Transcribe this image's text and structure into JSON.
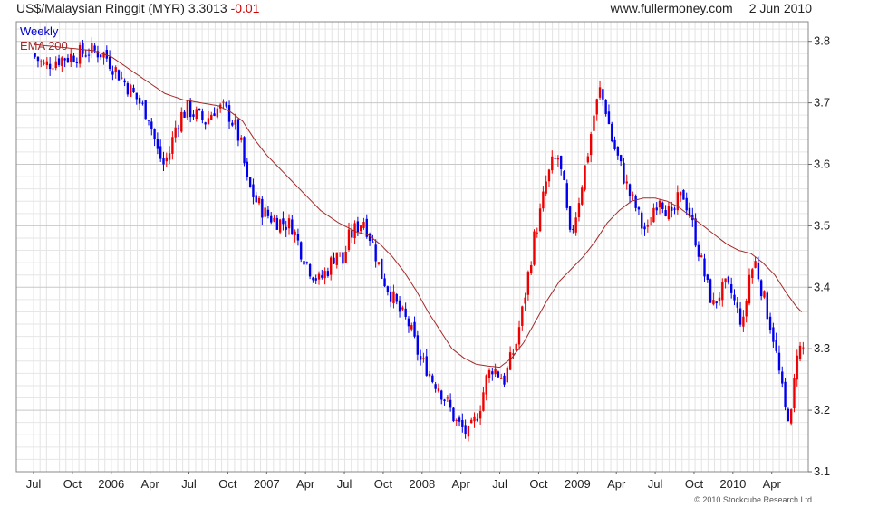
{
  "header": {
    "title": "US$/Malaysian Ringgit (MYR)",
    "last": "3.3013",
    "change": "-0.01",
    "site": "www.fullermoney.com",
    "date": "2 Jun 2010"
  },
  "copyright": "© 2010 Stockcube Research Ltd",
  "colors": {
    "up": "#0000ee",
    "down": "#ee0000",
    "ema": "#a52a2a",
    "grid": "#d8d8d8",
    "legend_weekly": "#0000cc",
    "legend_ema": "#a52a2a"
  },
  "chart_data": {
    "type": "candlestick",
    "legend": [
      {
        "name": "Weekly",
        "color": "#0000cc"
      },
      {
        "name": "EMA 200",
        "color": "#a52a2a"
      }
    ],
    "legend_position": "top-left",
    "grid": true,
    "y_axis_side": "right",
    "ylim": [
      3.1,
      3.82
    ],
    "y_ticks": [
      3.1,
      3.2,
      3.3,
      3.4,
      3.5,
      3.6,
      3.7,
      3.8
    ],
    "x_ticks": [
      {
        "week": 0,
        "label": "Jul"
      },
      {
        "week": 13,
        "label": "Oct"
      },
      {
        "week": 26,
        "label": "2006"
      },
      {
        "week": 39,
        "label": "Apr"
      },
      {
        "week": 52,
        "label": "Jul"
      },
      {
        "week": 65,
        "label": "Oct"
      },
      {
        "week": 78,
        "label": "2007"
      },
      {
        "week": 91,
        "label": "Apr"
      },
      {
        "week": 104,
        "label": "Jul"
      },
      {
        "week": 117,
        "label": "Oct"
      },
      {
        "week": 130,
        "label": "2008"
      },
      {
        "week": 143,
        "label": "Apr"
      },
      {
        "week": 156,
        "label": "Jul"
      },
      {
        "week": 169,
        "label": "Oct"
      },
      {
        "week": 182,
        "label": "2009"
      },
      {
        "week": 195,
        "label": "Apr"
      },
      {
        "week": 208,
        "label": "Jul"
      },
      {
        "week": 221,
        "label": "Oct"
      },
      {
        "week": 234,
        "label": "2010"
      },
      {
        "week": 247,
        "label": "Apr"
      }
    ],
    "weeks": 258,
    "close_anchors": [
      [
        0,
        3.78
      ],
      [
        4,
        3.76
      ],
      [
        8,
        3.77
      ],
      [
        12,
        3.775
      ],
      [
        16,
        3.78
      ],
      [
        20,
        3.785
      ],
      [
        24,
        3.78
      ],
      [
        27,
        3.76
      ],
      [
        30,
        3.74
      ],
      [
        33,
        3.72
      ],
      [
        36,
        3.7
      ],
      [
        39,
        3.68
      ],
      [
        42,
        3.62
      ],
      [
        44,
        3.6
      ],
      [
        46,
        3.62
      ],
      [
        48,
        3.66
      ],
      [
        50,
        3.68
      ],
      [
        52,
        3.69
      ],
      [
        55,
        3.68
      ],
      [
        58,
        3.67
      ],
      [
        61,
        3.69
      ],
      [
        64,
        3.69
      ],
      [
        66,
        3.68
      ],
      [
        68,
        3.66
      ],
      [
        70,
        3.63
      ],
      [
        72,
        3.57
      ],
      [
        75,
        3.54
      ],
      [
        78,
        3.52
      ],
      [
        81,
        3.51
      ],
      [
        84,
        3.505
      ],
      [
        87,
        3.5
      ],
      [
        90,
        3.46
      ],
      [
        93,
        3.43
      ],
      [
        96,
        3.41
      ],
      [
        99,
        3.43
      ],
      [
        102,
        3.46
      ],
      [
        104,
        3.44
      ],
      [
        106,
        3.48
      ],
      [
        109,
        3.5
      ],
      [
        111,
        3.51
      ],
      [
        114,
        3.47
      ],
      [
        117,
        3.42
      ],
      [
        120,
        3.39
      ],
      [
        123,
        3.36
      ],
      [
        126,
        3.34
      ],
      [
        128,
        3.31
      ],
      [
        130,
        3.28
      ],
      [
        132,
        3.27
      ],
      [
        134,
        3.25
      ],
      [
        136,
        3.24
      ],
      [
        138,
        3.22
      ],
      [
        140,
        3.2
      ],
      [
        142,
        3.18
      ],
      [
        144,
        3.17
      ],
      [
        146,
        3.16
      ],
      [
        148,
        3.18
      ],
      [
        150,
        3.21
      ],
      [
        152,
        3.25
      ],
      [
        154,
        3.27
      ],
      [
        156,
        3.26
      ],
      [
        158,
        3.25
      ],
      [
        160,
        3.28
      ],
      [
        162,
        3.31
      ],
      [
        164,
        3.36
      ],
      [
        166,
        3.42
      ],
      [
        168,
        3.48
      ],
      [
        170,
        3.52
      ],
      [
        172,
        3.57
      ],
      [
        174,
        3.6
      ],
      [
        176,
        3.61
      ],
      [
        178,
        3.56
      ],
      [
        180,
        3.48
      ],
      [
        182,
        3.52
      ],
      [
        184,
        3.57
      ],
      [
        186,
        3.62
      ],
      [
        188,
        3.68
      ],
      [
        190,
        3.72
      ],
      [
        192,
        3.69
      ],
      [
        194,
        3.64
      ],
      [
        196,
        3.61
      ],
      [
        198,
        3.58
      ],
      [
        200,
        3.55
      ],
      [
        202,
        3.53
      ],
      [
        204,
        3.5
      ],
      [
        206,
        3.49
      ],
      [
        208,
        3.53
      ],
      [
        210,
        3.55
      ],
      [
        212,
        3.53
      ],
      [
        214,
        3.51
      ],
      [
        216,
        3.54
      ],
      [
        218,
        3.55
      ],
      [
        220,
        3.52
      ],
      [
        222,
        3.48
      ],
      [
        224,
        3.44
      ],
      [
        226,
        3.4
      ],
      [
        228,
        3.37
      ],
      [
        230,
        3.39
      ],
      [
        232,
        3.4
      ],
      [
        234,
        3.39
      ],
      [
        236,
        3.36
      ],
      [
        238,
        3.34
      ],
      [
        240,
        3.42
      ],
      [
        242,
        3.44
      ],
      [
        244,
        3.4
      ],
      [
        246,
        3.36
      ],
      [
        248,
        3.32
      ],
      [
        250,
        3.26
      ],
      [
        252,
        3.2
      ],
      [
        254,
        3.19
      ],
      [
        256,
        3.3
      ],
      [
        258,
        3.3
      ]
    ],
    "ema_anchors": [
      [
        0,
        3.795
      ],
      [
        10,
        3.79
      ],
      [
        20,
        3.785
      ],
      [
        26,
        3.775
      ],
      [
        32,
        3.755
      ],
      [
        38,
        3.735
      ],
      [
        44,
        3.715
      ],
      [
        50,
        3.705
      ],
      [
        56,
        3.7
      ],
      [
        62,
        3.695
      ],
      [
        66,
        3.685
      ],
      [
        70,
        3.67
      ],
      [
        74,
        3.64
      ],
      [
        78,
        3.615
      ],
      [
        84,
        3.585
      ],
      [
        90,
        3.555
      ],
      [
        96,
        3.525
      ],
      [
        102,
        3.505
      ],
      [
        108,
        3.49
      ],
      [
        112,
        3.485
      ],
      [
        116,
        3.47
      ],
      [
        120,
        3.45
      ],
      [
        124,
        3.425
      ],
      [
        128,
        3.395
      ],
      [
        132,
        3.36
      ],
      [
        136,
        3.33
      ],
      [
        140,
        3.3
      ],
      [
        144,
        3.285
      ],
      [
        148,
        3.275
      ],
      [
        152,
        3.272
      ],
      [
        156,
        3.27
      ],
      [
        160,
        3.285
      ],
      [
        164,
        3.31
      ],
      [
        168,
        3.345
      ],
      [
        172,
        3.38
      ],
      [
        176,
        3.41
      ],
      [
        180,
        3.43
      ],
      [
        184,
        3.45
      ],
      [
        188,
        3.475
      ],
      [
        192,
        3.505
      ],
      [
        196,
        3.525
      ],
      [
        200,
        3.54
      ],
      [
        204,
        3.545
      ],
      [
        208,
        3.545
      ],
      [
        212,
        3.54
      ],
      [
        216,
        3.53
      ],
      [
        220,
        3.515
      ],
      [
        224,
        3.5
      ],
      [
        228,
        3.485
      ],
      [
        232,
        3.47
      ],
      [
        236,
        3.46
      ],
      [
        240,
        3.455
      ],
      [
        244,
        3.44
      ],
      [
        248,
        3.42
      ],
      [
        252,
        3.39
      ],
      [
        255,
        3.37
      ],
      [
        257,
        3.36
      ]
    ]
  }
}
